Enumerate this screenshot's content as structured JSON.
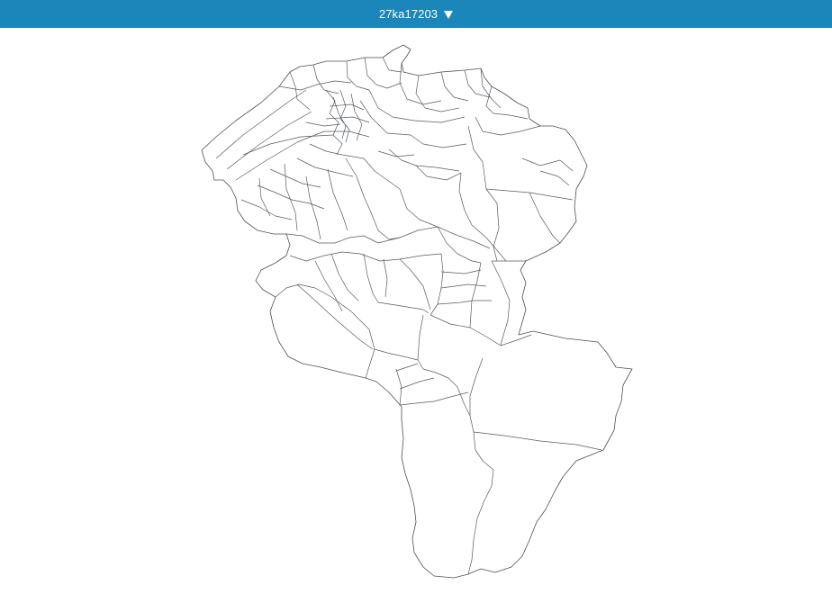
{
  "header": {
    "title": "27ka17203",
    "dropdown_icon": "triangle-down-icon",
    "accent_color": "#1a86b9"
  },
  "map": {
    "stroke_color": "#555a60",
    "background_color": "#ffffff"
  }
}
